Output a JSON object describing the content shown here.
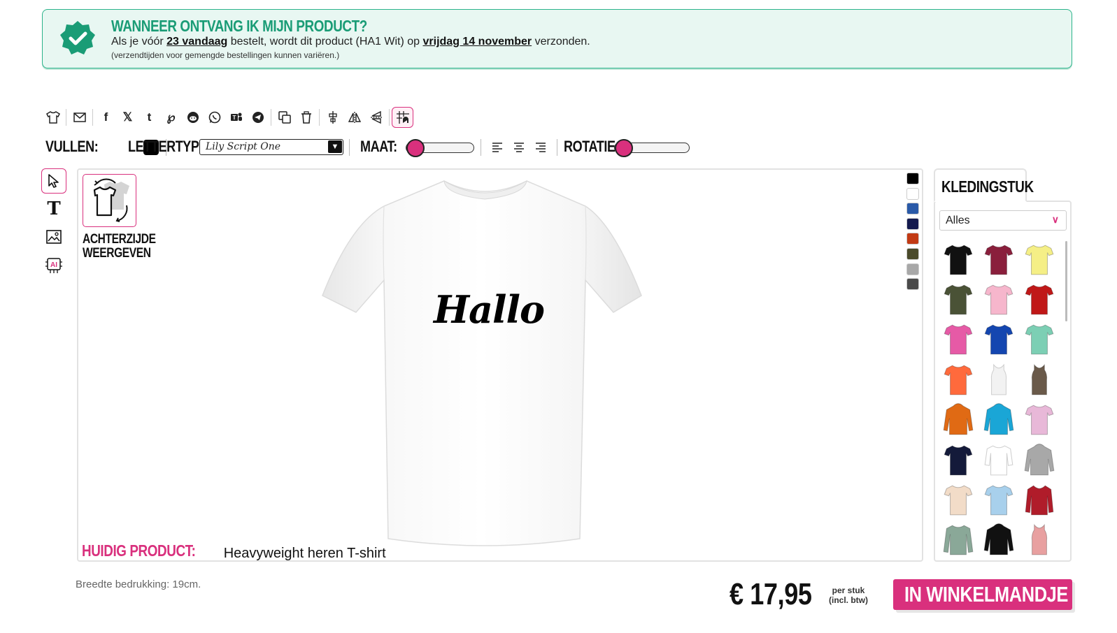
{
  "banner": {
    "title": "WANNEER ONTVANG IK MIJN PRODUCT?",
    "line1_pre": "Als je vóór ",
    "line1_deadline": "23 vandaag",
    "line1_mid": " bestelt, wordt dit product (HA1 Wit) op ",
    "line1_date": "vrijdag 14 november",
    "line1_post": " verzonden.",
    "line2": "(verzendtijden voor gemengde bestellingen kunnen variëren.)",
    "accent": "#1a9c76"
  },
  "toolbar": {
    "icons": [
      "tshirt-icon",
      "mail-icon",
      "facebook-icon",
      "x-icon",
      "tumblr-icon",
      "pinterest-icon",
      "reddit-icon",
      "whatsapp-icon",
      "teams-icon",
      "telegram-icon",
      "duplicate-icon",
      "trash-icon",
      "align-center-icon",
      "flip-horizontal-icon",
      "flip-vertical-icon",
      "snap-grid-icon"
    ]
  },
  "props": {
    "fill_label": "VULLEN:",
    "font_label": "LETTERTYPE:",
    "font_value": "Lily Script One",
    "size_label": "MAAT:",
    "rotation_label": "ROTATIE:",
    "fill_color": "#000000",
    "size_level": 0,
    "rotation_level": 0
  },
  "canvas": {
    "back_label_1": "ACHTERZIJDE",
    "back_label_2": "WEERGEVEN",
    "design_text": "Hallo",
    "current_label": "HUIDIG PRODUCT:",
    "current_value": "Heavyweight heren T-shirt",
    "shirt_colors": [
      "#000000",
      "#ffffff",
      "#2a5aa8",
      "#141a4e",
      "#c23a14",
      "#4a4a2a",
      "#a8a8a8",
      "#4a4a4a"
    ]
  },
  "panel": {
    "tab_label": "KLEDINGSTUK",
    "category_value": "Alles",
    "garments": [
      {
        "color": "#111111",
        "type": "tee"
      },
      {
        "color": "#8a1f3c",
        "type": "tee"
      },
      {
        "color": "#f5ef86",
        "type": "tee"
      },
      {
        "color": "#4a5236",
        "type": "tee"
      },
      {
        "color": "#f6b6cc",
        "type": "tee"
      },
      {
        "color": "#c01818",
        "type": "tee"
      },
      {
        "color": "#e65aa6",
        "type": "tee"
      },
      {
        "color": "#1446b0",
        "type": "tee"
      },
      {
        "color": "#7ccfb4",
        "type": "tee"
      },
      {
        "color": "#ff6a3c",
        "type": "tee"
      },
      {
        "color": "#f2f2f2",
        "type": "tank"
      },
      {
        "color": "#6a5a4a",
        "type": "tank"
      },
      {
        "color": "#e06a14",
        "type": "hoodie"
      },
      {
        "color": "#1aa6d6",
        "type": "hoodie"
      },
      {
        "color": "#e8b8d8",
        "type": "tee"
      },
      {
        "color": "#141a3a",
        "type": "tee"
      },
      {
        "color": "#ffffff",
        "type": "raglan"
      },
      {
        "color": "#a8a8a8",
        "type": "hoodie"
      },
      {
        "color": "#f2dcc8",
        "type": "tee"
      },
      {
        "color": "#a8d0ec",
        "type": "tee"
      },
      {
        "color": "#b01c2a",
        "type": "jacket"
      },
      {
        "color": "#8aa898",
        "type": "longsleeve"
      },
      {
        "color": "#111111",
        "type": "hoodie"
      },
      {
        "color": "#e8a0a0",
        "type": "tank"
      }
    ]
  },
  "footer": {
    "width_note": "Breedte bedrukking: 19cm.",
    "price": "€ 17,95",
    "per_1": "per stuk",
    "per_2": "(incl. btw)",
    "cart_label": "IN WINKELMANDJE",
    "brand": "#d9307d"
  }
}
